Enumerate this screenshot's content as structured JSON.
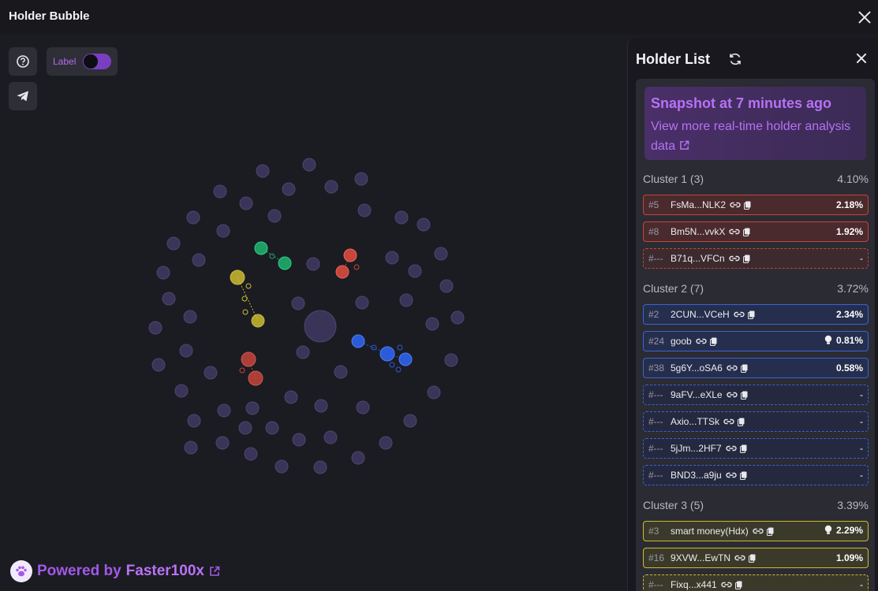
{
  "app": {
    "title": "Holder Bubble"
  },
  "toolbar": {
    "label_text": "Label",
    "label_on": true
  },
  "footer": {
    "powered_prefix": "Powered by",
    "brand": "Faster100x"
  },
  "panel": {
    "title": "Holder List",
    "snapshot": {
      "heading": "Snapshot at 7 minutes ago",
      "link_text": "View more real-time holder analysis data"
    },
    "clusters": [
      {
        "name": "Cluster 1 (3)",
        "percent": "4.10%",
        "color": "#c7453b",
        "rows": [
          {
            "rank": "#5",
            "address": "FsMa...NLK2",
            "value": "2.18%",
            "bulb": false
          },
          {
            "rank": "#8",
            "address": "Bm5N...vvkX",
            "value": "1.92%",
            "bulb": false
          },
          {
            "rank": "#---",
            "address": "B71q...VFCn",
            "value": "-",
            "bulb": false
          }
        ]
      },
      {
        "name": "Cluster 2 (7)",
        "percent": "3.72%",
        "color": "#3a63d8",
        "rows": [
          {
            "rank": "#2",
            "address": "2CUN...VCeH",
            "value": "2.34%",
            "bulb": false
          },
          {
            "rank": "#24",
            "address": "goob",
            "value": "0.81%",
            "bulb": true
          },
          {
            "rank": "#38",
            "address": "5g6Y...oSA6",
            "value": "0.58%",
            "bulb": false
          },
          {
            "rank": "#---",
            "address": "9aFV...eXLe",
            "value": "-",
            "bulb": false
          },
          {
            "rank": "#---",
            "address": "Axio...TTSk",
            "value": "-",
            "bulb": false
          },
          {
            "rank": "#---",
            "address": "5jJm...2HF7",
            "value": "-",
            "bulb": false
          },
          {
            "rank": "#---",
            "address": "BND3...a9ju",
            "value": "-",
            "bulb": false
          }
        ]
      },
      {
        "name": "Cluster 3 (5)",
        "percent": "3.39%",
        "color": "#cdbb2f",
        "rows": [
          {
            "rank": "#3",
            "address": "smart money(Hdx)",
            "value": "2.29%",
            "bulb": true
          },
          {
            "rank": "#16",
            "address": "9XVW...EwTN",
            "value": "1.09%",
            "bulb": false
          },
          {
            "rank": "#---",
            "address": "Fixq...x441",
            "value": "-",
            "bulb": false
          }
        ]
      }
    ]
  },
  "icons": {
    "help": "question-circle-icon",
    "share": "telegram-icon",
    "refresh": "refresh-icon",
    "link": "link-icon",
    "copy": "copy-icon",
    "bulb": "lightbulb-icon",
    "external": "external-link-icon",
    "paw": "paw-icon"
  },
  "colors": {
    "accent": "#a259e6",
    "bubble": "#3a3458",
    "cluster1": "#c7453b",
    "cluster2": "#2b5bd8",
    "cluster3": "#cdbb2f",
    "cluster4": "#1e9e62"
  }
}
